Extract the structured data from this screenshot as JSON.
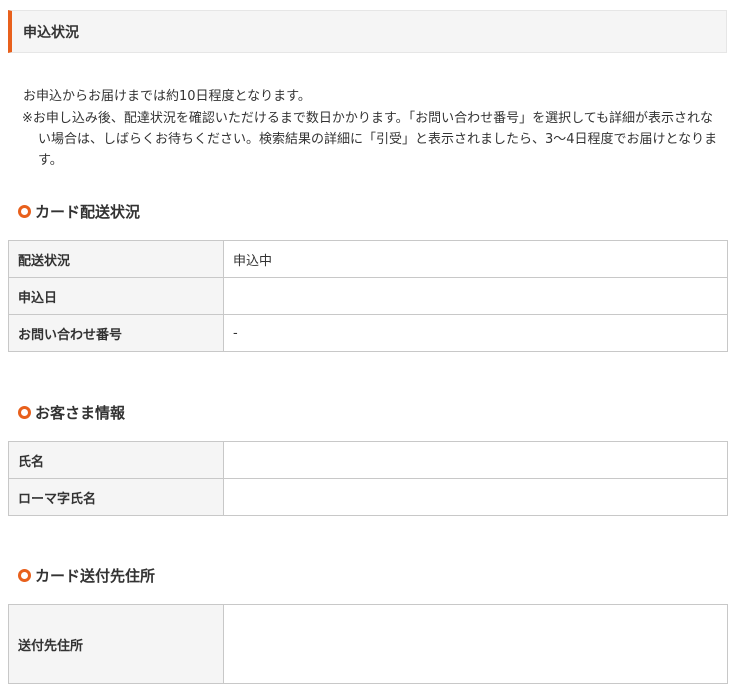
{
  "page_title": "申込状況",
  "intro": {
    "line1": "お申込からお届けまでは約10日程度となります。",
    "note": "※お申し込み後、配達状況を確認いただけるまで数日かかります。「お問い合わせ番号」を選択しても詳細が表示されない場合は、しばらくお待ちください。検索結果の詳細に「引受」と表示されましたら、3〜4日程度でお届けとなります。"
  },
  "sections": {
    "delivery": {
      "heading": "カード配送状況",
      "rows": [
        {
          "label": "配送状況",
          "value": "申込中"
        },
        {
          "label": "申込日",
          "value": ""
        },
        {
          "label": "お問い合わせ番号",
          "value": "-"
        }
      ]
    },
    "customer": {
      "heading": "お客さま情報",
      "rows": [
        {
          "label": "氏名",
          "value": ""
        },
        {
          "label": "ローマ字氏名",
          "value": ""
        }
      ]
    },
    "address": {
      "heading": "カード送付先住所",
      "rows": [
        {
          "label": "送付先住所",
          "value": ""
        }
      ]
    }
  },
  "colors": {
    "accent": "#e8601c",
    "label_bg": "#f5f5f5",
    "border": "#c8c8c8"
  }
}
